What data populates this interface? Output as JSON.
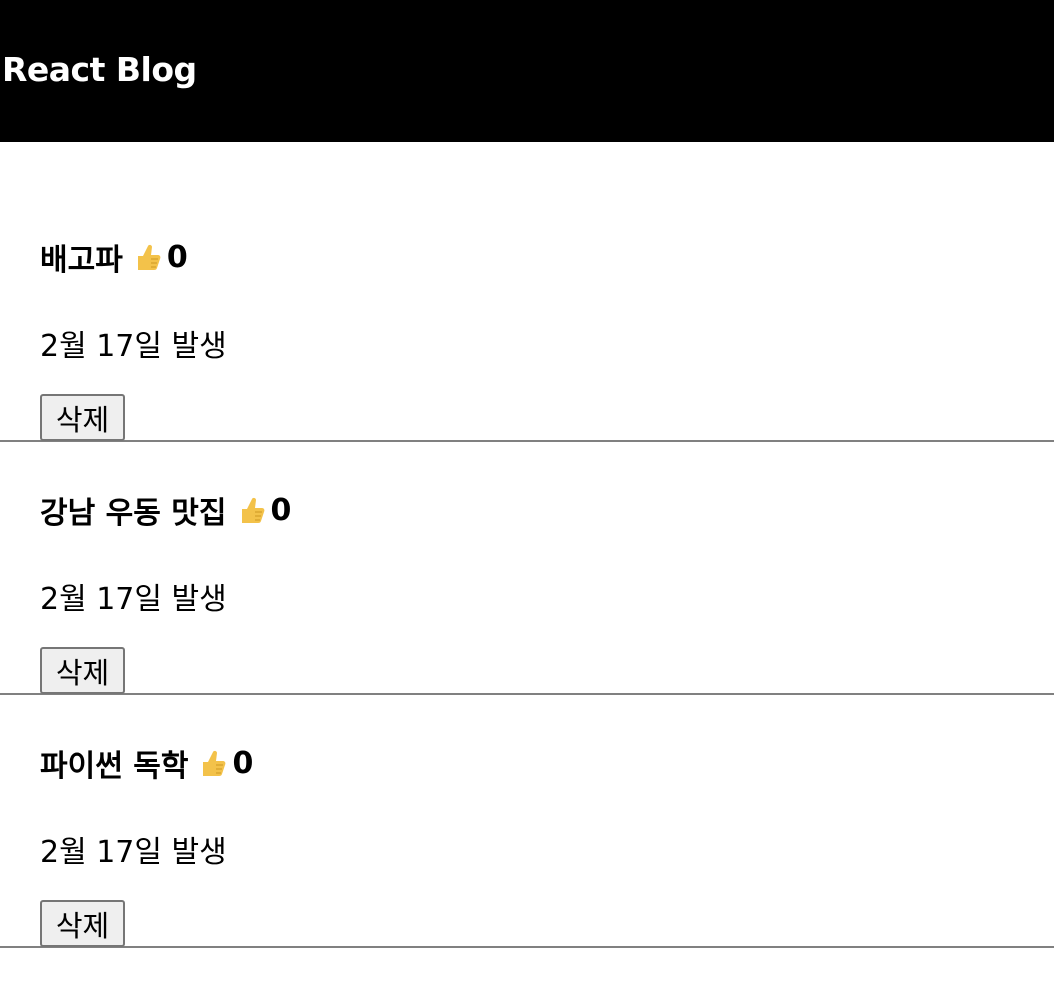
{
  "navbar": {
    "title": "React Blog"
  },
  "posts": [
    {
      "title": "배고파",
      "like_icon": "thumbs-up-icon",
      "likes": "0",
      "date": "2월 17일 발생",
      "delete_label": "삭제"
    },
    {
      "title": "강남 우동 맛집",
      "like_icon": "thumbs-up-icon",
      "likes": "0",
      "date": "2월 17일 발생",
      "delete_label": "삭제"
    },
    {
      "title": "파이썬 독학",
      "like_icon": "thumbs-up-icon",
      "likes": "0",
      "date": "2월 17일 발생",
      "delete_label": "삭제"
    }
  ],
  "colors": {
    "navbar_bg": "#000000",
    "navbar_text": "#ffffff",
    "divider": "#808080",
    "thumb": "#f3c24a"
  }
}
